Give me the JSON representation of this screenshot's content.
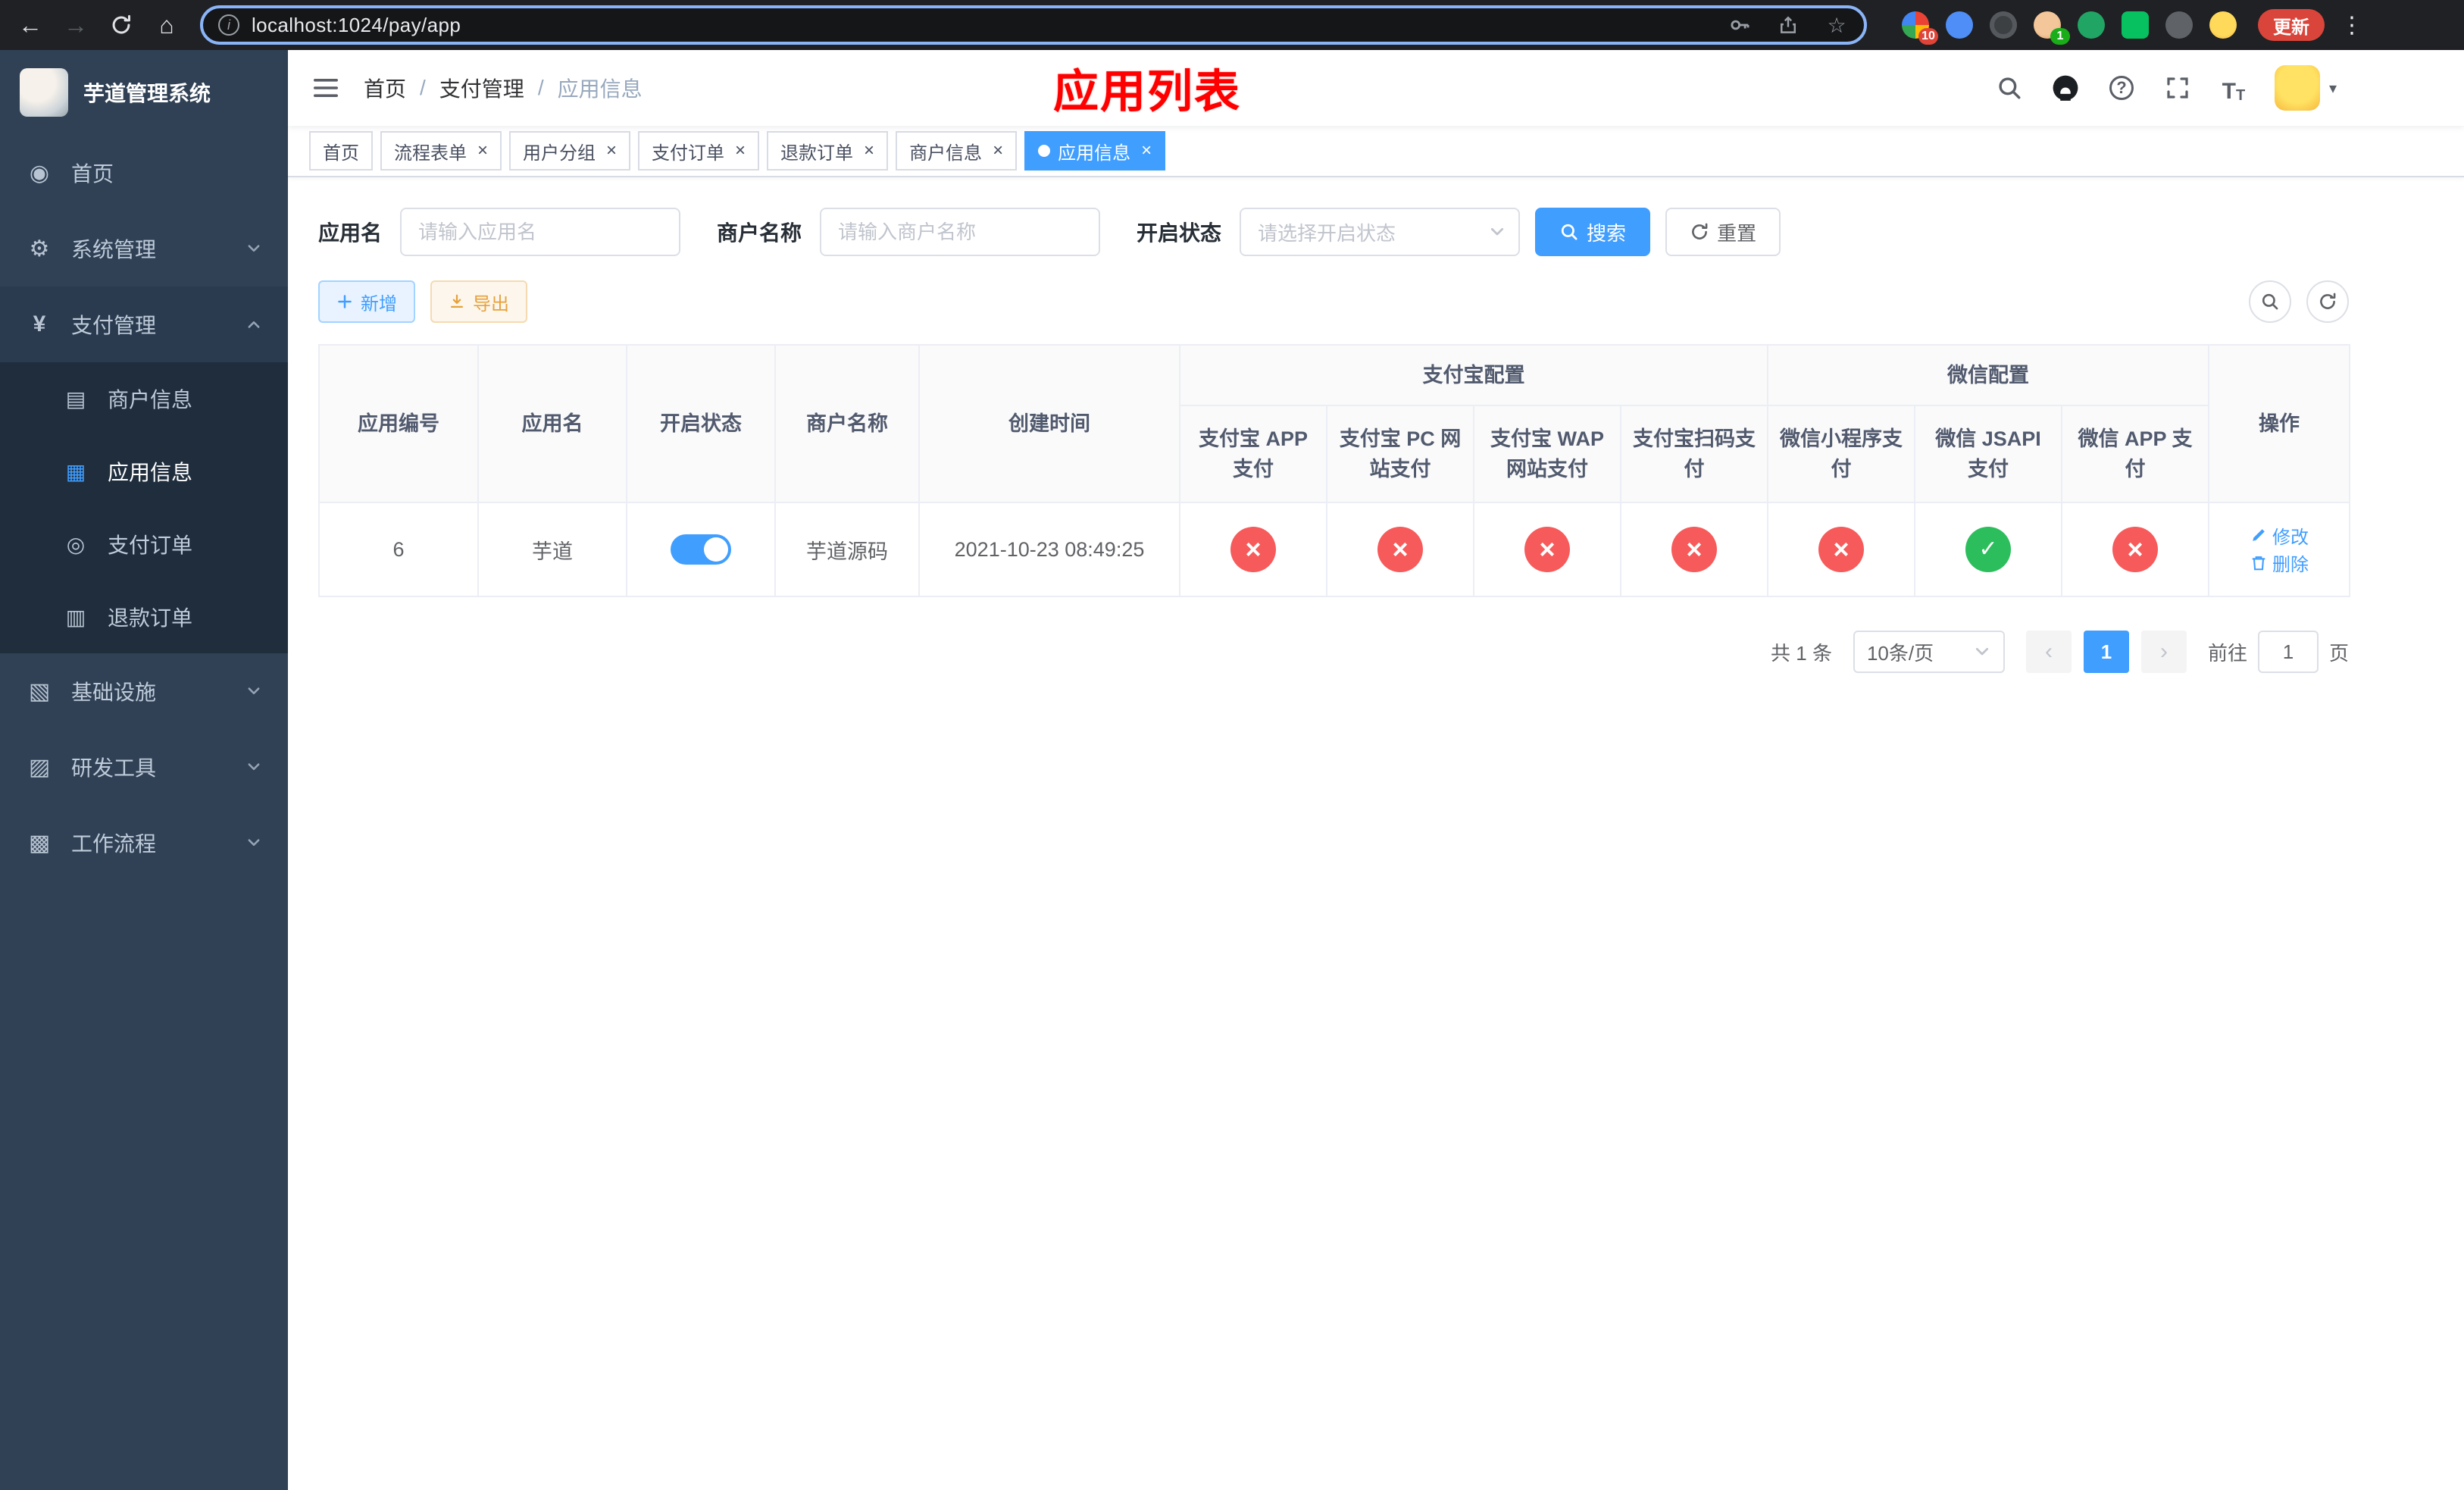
{
  "colors": {
    "accent": "#409eff",
    "success": "#2cbe5d",
    "danger": "#f75a5a",
    "warning": "#e6a23c",
    "annotation": "#ff0000",
    "sidebar_bg": "#304156",
    "submenu_bg": "#1f2d3d"
  },
  "browser": {
    "url": "localhost:1024/pay/app",
    "update_label": "更新",
    "ext_badge_grid": "10",
    "ext_badge_avatar": "1"
  },
  "sidebar": {
    "app_title": "芋道管理系统",
    "items": {
      "home": "首页",
      "system": "系统管理",
      "payment": "支付管理",
      "merchant_info": "商户信息",
      "app_info": "应用信息",
      "pay_order": "支付订单",
      "refund_order": "退款订单",
      "infrastructure": "基础设施",
      "dev_tools": "研发工具",
      "workflow": "工作流程"
    }
  },
  "navbar": {
    "breadcrumb": {
      "level1": "首页",
      "level2": "支付管理",
      "level3": "应用信息"
    },
    "annotation": "应用列表"
  },
  "tabs": {
    "items": [
      {
        "label": "首页"
      },
      {
        "label": "流程表单"
      },
      {
        "label": "用户分组"
      },
      {
        "label": "支付订单"
      },
      {
        "label": "退款订单"
      },
      {
        "label": "商户信息"
      },
      {
        "label": "应用信息"
      }
    ]
  },
  "filters": {
    "app_name_label": "应用名",
    "app_name_placeholder": "请输入应用名",
    "merchant_label": "商户名称",
    "merchant_placeholder": "请输入商户名称",
    "status_label": "开启状态",
    "status_placeholder": "请选择开启状态",
    "search_label": "搜索",
    "reset_label": "重置"
  },
  "toolbar": {
    "add_label": "新增",
    "export_label": "导出"
  },
  "table": {
    "groups": {
      "alipay": "支付宝配置",
      "wechat": "微信配置"
    },
    "headers": {
      "id": "应用编号",
      "name": "应用名",
      "status": "开启状态",
      "merchant": "商户名称",
      "created": "创建时间",
      "alipay_app": "支付宝 APP 支付",
      "alipay_pc": "支付宝 PC 网站支付",
      "alipay_wap": "支付宝 WAP 网站支付",
      "alipay_qr": "支付宝扫码支付",
      "wx_mini": "微信小程序支付",
      "wx_jsapi": "微信 JSAPI 支付",
      "wx_app": "微信 APP 支付",
      "actions": "操作"
    },
    "row": {
      "id": "6",
      "name": "芋道",
      "enabled": true,
      "merchant": "芋道源码",
      "created": "2021-10-23 08:49:25",
      "statuses": {
        "alipay_app": false,
        "alipay_pc": false,
        "alipay_wap": false,
        "alipay_qr": false,
        "wx_mini": false,
        "wx_jsapi": true,
        "wx_app": false
      },
      "edit_label": "修改",
      "delete_label": "删除"
    }
  },
  "pagination": {
    "total": "共 1 条",
    "page_size": "10条/页",
    "page": "1",
    "goto_label": "前往",
    "goto_value": "1",
    "goto_unit": "页"
  }
}
